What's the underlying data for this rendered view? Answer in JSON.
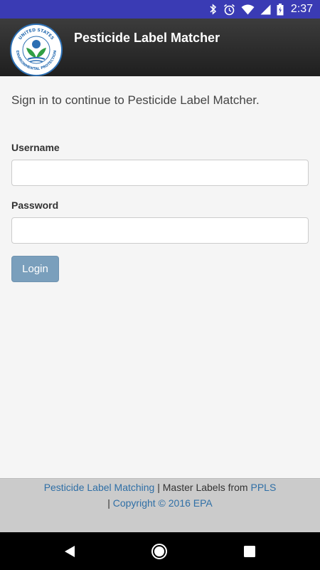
{
  "status_bar": {
    "time": "2:37",
    "icons": [
      "bluetooth-icon",
      "alarm-icon",
      "wifi-icon",
      "signal-icon",
      "battery-charging-icon"
    ]
  },
  "header": {
    "logo_text_top": "UNITED STATES",
    "logo_text_bottom": "ENVIRONMENTAL PROTECTION",
    "title": "Pesticide Label Matcher"
  },
  "login": {
    "intro": "Sign in to continue to Pesticide Label Matcher.",
    "username_label": "Username",
    "username_value": "",
    "password_label": "Password",
    "password_value": "",
    "login_button": "Login"
  },
  "footer": {
    "link_app": "Pesticide Label Matching",
    "separator1": " | ",
    "text_master": "Master Labels from ",
    "link_ppls": "PPLS",
    "separator2": "| ",
    "link_copyright": "Copyright © 2016 EPA"
  },
  "colors": {
    "status_bar": "#3a3bb4",
    "header_bg": "#2a2a2a",
    "login_button": "#7a9fbc",
    "link": "#2f6fa6",
    "footer_bg": "#cbcbcb"
  }
}
